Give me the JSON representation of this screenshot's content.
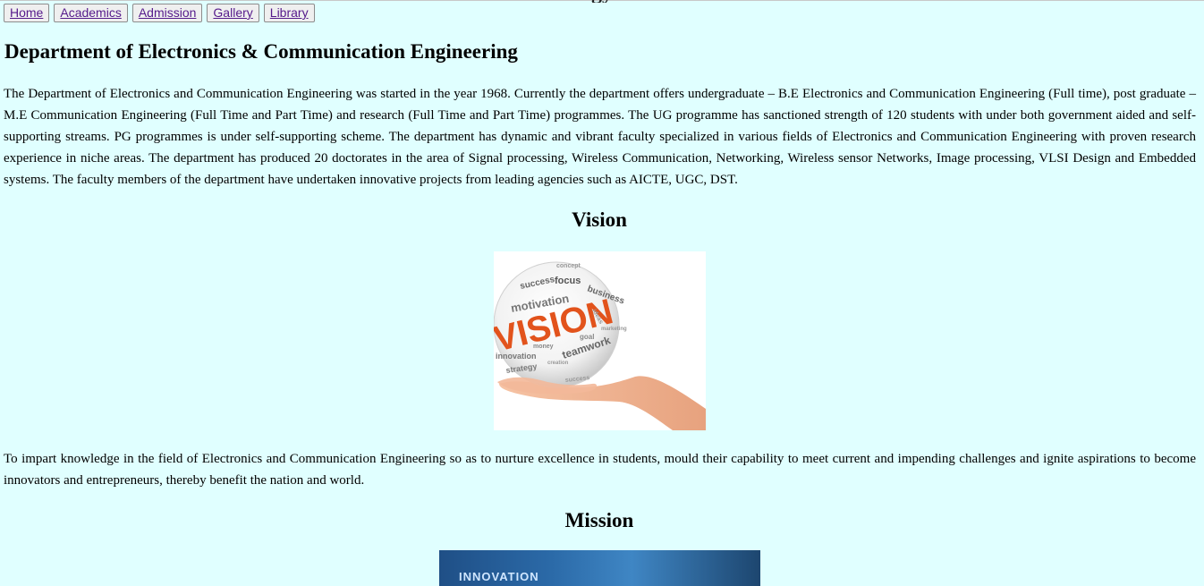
{
  "nav": {
    "items": [
      {
        "label": "Home"
      },
      {
        "label": "Academics"
      },
      {
        "label": "Admission"
      },
      {
        "label": "Gallery"
      },
      {
        "label": "Library"
      }
    ]
  },
  "page": {
    "title": "Department of Electronics & Communication Engineering",
    "intro": "The Department of Electronics and Communication Engineering was started in the year 1968. Currently the department offers undergraduate – B.E Electronics and Communication Engineering (Full time), post graduate – M.E Communication Engineering (Full Time and Part Time) and research (Full Time and Part Time) programmes. The UG programme has sanctioned strength of 120 students with under both government aided and self-supporting streams. PG programmes is under self-supporting scheme. The department has dynamic and vibrant faculty specialized in various fields of Electronics and Communication Engineering with proven research experience in niche areas. The department has produced 20 doctorates in the area of Signal processing, Wireless Communication, Networking, Wireless sensor Networks, Image processing, VLSI Design and Embedded systems. The faculty members of the department have undertaken innovative projects from leading agencies such as AICTE, UGC, DST."
  },
  "vision": {
    "heading": "Vision",
    "image_words": [
      "VISION",
      "motivation",
      "success",
      "focus",
      "business",
      "teamwork",
      "strategy",
      "innovation",
      "goal",
      "concept",
      "ideas",
      "marketing",
      "money",
      "creation",
      "success"
    ],
    "text": "To impart knowledge in the field of Electronics and Communication Engineering so as to nurture excellence in students, mould their capability to meet current and impending challenges and ignite aspirations to become innovators and entrepreneurs, thereby benefit the nation and world."
  },
  "mission": {
    "heading": "Mission",
    "image_text": "INNOVATION"
  },
  "colors": {
    "page_background": "#e0ffff",
    "link": "#551a8b",
    "vision_orange": "#e2531c"
  }
}
